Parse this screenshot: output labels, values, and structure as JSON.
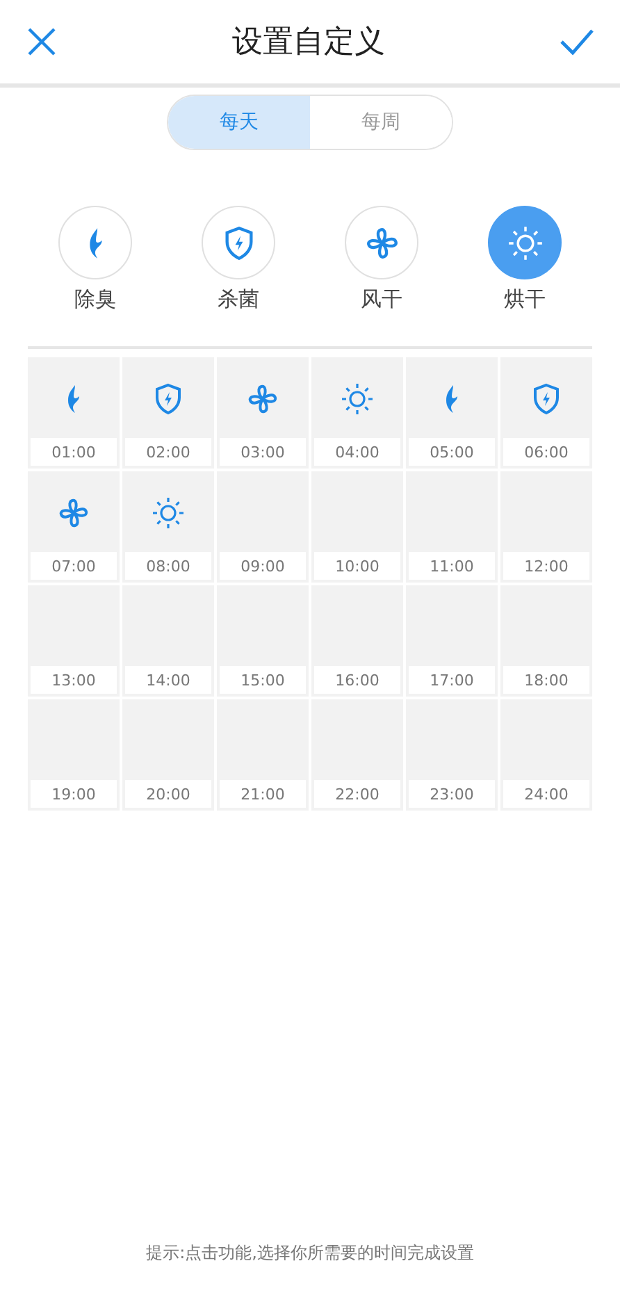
{
  "header": {
    "title": "设置自定义"
  },
  "period_tabs": [
    {
      "label": "每天",
      "selected": true
    },
    {
      "label": "每周",
      "selected": false
    }
  ],
  "functions": [
    {
      "kind": "flame",
      "label": "除臭",
      "selected": false
    },
    {
      "kind": "shield",
      "label": "杀菌",
      "selected": false
    },
    {
      "kind": "fan",
      "label": "风干",
      "selected": false
    },
    {
      "kind": "sun",
      "label": "烘干",
      "selected": true
    }
  ],
  "slots": [
    {
      "time": "01:00",
      "kind": "flame"
    },
    {
      "time": "02:00",
      "kind": "shield"
    },
    {
      "time": "03:00",
      "kind": "fan"
    },
    {
      "time": "04:00",
      "kind": "sun"
    },
    {
      "time": "05:00",
      "kind": "flame"
    },
    {
      "time": "06:00",
      "kind": "shield"
    },
    {
      "time": "07:00",
      "kind": "fan"
    },
    {
      "time": "08:00",
      "kind": "sun"
    },
    {
      "time": "09:00"
    },
    {
      "time": "10:00"
    },
    {
      "time": "11:00"
    },
    {
      "time": "12:00"
    },
    {
      "time": "13:00"
    },
    {
      "time": "14:00"
    },
    {
      "time": "15:00"
    },
    {
      "time": "16:00"
    },
    {
      "time": "17:00"
    },
    {
      "time": "18:00"
    },
    {
      "time": "19:00"
    },
    {
      "time": "20:00"
    },
    {
      "time": "21:00"
    },
    {
      "time": "22:00"
    },
    {
      "time": "23:00"
    },
    {
      "time": "24:00"
    }
  ],
  "hint": "提示:点击功能,选择你所需要的时间完成设置"
}
